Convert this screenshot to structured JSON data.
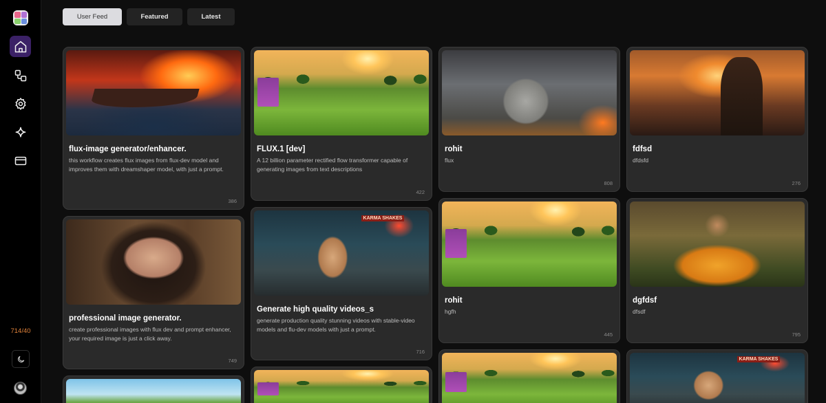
{
  "sidebar": {
    "credits": "714/40",
    "logo_colors": [
      "#e8658a",
      "#8ad06c",
      "#6a8fe0",
      "#b071d6"
    ]
  },
  "tabs": [
    {
      "label": "User Feed",
      "active": true
    },
    {
      "label": "Featured",
      "active": false
    },
    {
      "label": "Latest",
      "active": false
    }
  ],
  "cards": [
    {
      "title": "flux-image generator/enhancer.",
      "description": "this workflow creates flux images from flux-dev model and improves them with dreamshaper model, with just a prompt.",
      "count": "386"
    },
    {
      "title": "FLUX.1 [dev]",
      "description": "A 12 billion parameter rectified flow transformer capable of generating images from text descriptions",
      "count": "422"
    },
    {
      "title": "rohit",
      "description": "flux",
      "count": "808"
    },
    {
      "title": "fdfsd",
      "description": "dfdsfd",
      "count": "276"
    },
    {
      "title": "professional image generator.",
      "description": "create professional images with flux dev and prompt enhancer, your required image is just a click away.",
      "count": "749"
    },
    {
      "title": "Generate high quality videos_s",
      "description": "generate production quality stunning videos with stable-video models and flu-dev models with just a prompt.",
      "count": "716"
    },
    {
      "title": "rohit",
      "description": "hgfh",
      "count": "445"
    },
    {
      "title": "dgfdsf",
      "description": "dfsdf",
      "count": "795"
    }
  ],
  "images": {
    "fox_sign": "KARMA SHAKES"
  },
  "accent": "#3b2166",
  "credits_color": "#e0823a"
}
